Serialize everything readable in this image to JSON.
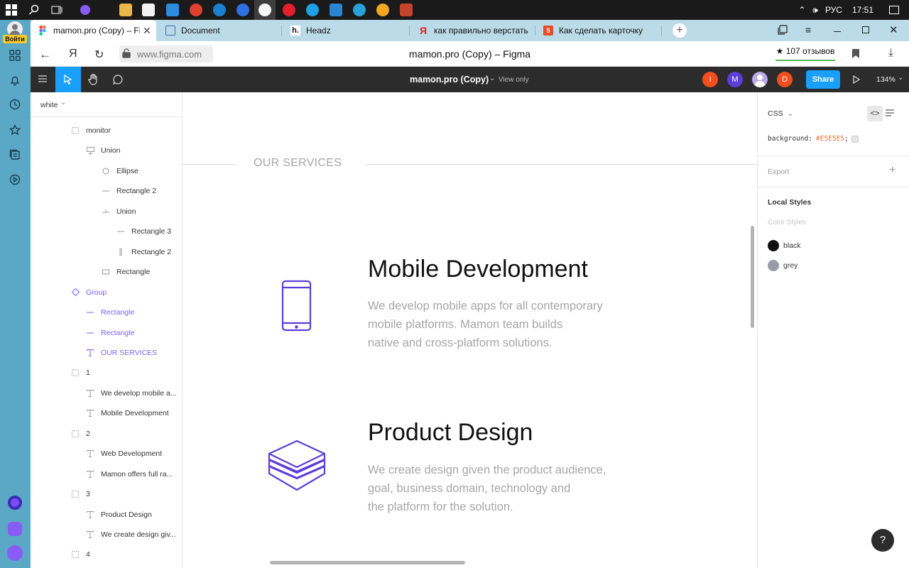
{
  "taskbar": {
    "time": "17:51",
    "language": "РУС"
  },
  "browser_sidebar": {
    "login_label": "Войти"
  },
  "tabs": [
    {
      "title": "mamon.pro (Copy) – Figma",
      "active": true
    },
    {
      "title": "Document"
    },
    {
      "title": "Headz"
    },
    {
      "title": "как правильно верстать к"
    },
    {
      "title": "Как сделать карточку"
    }
  ],
  "address_bar": {
    "url": "www.figma.com",
    "page_title": "mamon.pro (Copy) – Figma",
    "reviews": "★ 107 отзывов"
  },
  "figma_toolbar": {
    "file_name": "mamon.pro (Copy)",
    "mode": "View only",
    "avatars": [
      {
        "letter": "I",
        "color": "#f24e1e"
      },
      {
        "letter": "M",
        "color": "#5b3fd9"
      },
      {
        "letter": "",
        "color": "#b9a9e6"
      },
      {
        "letter": "D",
        "color": "#f24e1e"
      }
    ],
    "share_label": "Share",
    "zoom": "134%"
  },
  "layers_panel": {
    "page_name": "white",
    "items": [
      {
        "label": "monitor",
        "icon": "frame-icon",
        "selected": false
      },
      {
        "label": "Union",
        "icon": "monitor-icon",
        "selected": false
      },
      {
        "label": "Ellipse",
        "icon": "ellipse-icon",
        "selected": false
      },
      {
        "label": "Rectangle 2",
        "icon": "line-icon",
        "selected": false
      },
      {
        "label": "Union",
        "icon": "union-icon",
        "selected": false
      },
      {
        "label": "Rectangle 3",
        "icon": "line-icon",
        "selected": false
      },
      {
        "label": "Rectangle 2",
        "icon": "vline-icon",
        "selected": false
      },
      {
        "label": "Rectangle",
        "icon": "rect-icon",
        "selected": false
      },
      {
        "label": "Group",
        "icon": "group-icon",
        "selected": true
      },
      {
        "label": "Rectangle",
        "icon": "line-icon",
        "selected": true
      },
      {
        "label": "Rectangle",
        "icon": "line-icon",
        "selected": true
      },
      {
        "label": "OUR SERVICES",
        "icon": "text-icon",
        "selected": true
      },
      {
        "label": "1",
        "icon": "frame-icon",
        "selected": false
      },
      {
        "label": "We develop mobile a...",
        "icon": "text-icon",
        "selected": false
      },
      {
        "label": "Mobile Development",
        "icon": "text-icon",
        "selected": false
      },
      {
        "label": "2",
        "icon": "frame-icon",
        "selected": false
      },
      {
        "label": "Web Development",
        "icon": "text-icon",
        "selected": false
      },
      {
        "label": "Mamon offers full ra...",
        "icon": "text-icon",
        "selected": false
      },
      {
        "label": "3",
        "icon": "frame-icon",
        "selected": false
      },
      {
        "label": "Product Design",
        "icon": "text-icon",
        "selected": false
      },
      {
        "label": "We create design giv...",
        "icon": "text-icon",
        "selected": false
      },
      {
        "label": "4",
        "icon": "frame-icon",
        "selected": false
      }
    ]
  },
  "canvas": {
    "section_title": "OUR SERVICES",
    "services": [
      {
        "title": "Mobile Development",
        "lines": [
          "We develop mobile apps for all contemporary",
          "mobile platforms. Mamon team builds",
          "native and cross-platform solutions."
        ],
        "icon": "smartphone-icon"
      },
      {
        "title": "Product Design",
        "lines": [
          "We create design given the product audience,",
          "goal, business domain, technology and",
          "the platform for the solution."
        ],
        "icon": "layers-stack-icon"
      }
    ],
    "accent_color": "#5b3fd9"
  },
  "right_panel": {
    "code_lang": "CSS",
    "css_property": "background:",
    "css_value": "#E5E5E5",
    "css_end": ";",
    "export_label": "Export",
    "local_styles_label": "Local Styles",
    "color_styles_label": "Color Styles",
    "styles": [
      {
        "name": "black",
        "color": "#111111"
      },
      {
        "name": "grey",
        "color": "#9a9ba8"
      }
    ]
  },
  "help_label": "?"
}
